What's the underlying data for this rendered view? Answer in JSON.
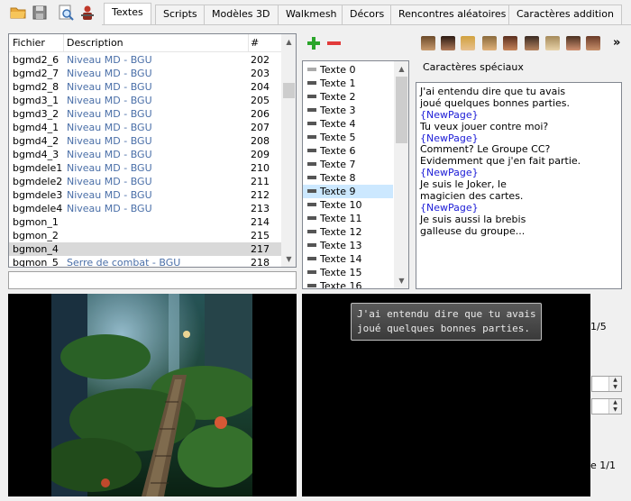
{
  "toolbar": {
    "icons": [
      "open-folder-icon",
      "save-icon",
      "search-document-icon",
      "character-icon"
    ]
  },
  "tabs": [
    {
      "label": "Textes",
      "active": true
    },
    {
      "label": "Scripts",
      "active": false
    },
    {
      "label": "Modèles 3D",
      "active": false
    },
    {
      "label": "Walkmesh",
      "active": false
    },
    {
      "label": "Décors",
      "active": false
    },
    {
      "label": "Rencontres aléatoires",
      "active": false
    },
    {
      "label": "Caractères addition",
      "active": false
    }
  ],
  "file_list": {
    "headers": {
      "file": "Fichier",
      "description": "Description",
      "number": "#"
    },
    "rows": [
      {
        "file": "bgmd2_6",
        "description": "Niveau MD - BGU",
        "number": "202"
      },
      {
        "file": "bgmd2_7",
        "description": "Niveau MD - BGU",
        "number": "203"
      },
      {
        "file": "bgmd2_8",
        "description": "Niveau MD - BGU",
        "number": "204"
      },
      {
        "file": "bgmd3_1",
        "description": "Niveau MD - BGU",
        "number": "205"
      },
      {
        "file": "bgmd3_2",
        "description": "Niveau MD - BGU",
        "number": "206"
      },
      {
        "file": "bgmd4_1",
        "description": "Niveau MD - BGU",
        "number": "207"
      },
      {
        "file": "bgmd4_2",
        "description": "Niveau MD - BGU",
        "number": "208"
      },
      {
        "file": "bgmd4_3",
        "description": "Niveau MD - BGU",
        "number": "209"
      },
      {
        "file": "bgmdele1",
        "description": "Niveau MD - BGU",
        "number": "210"
      },
      {
        "file": "bgmdele2",
        "description": "Niveau MD - BGU",
        "number": "211"
      },
      {
        "file": "bgmdele3",
        "description": "Niveau MD - BGU",
        "number": "212"
      },
      {
        "file": "bgmdele4",
        "description": "Niveau MD - BGU",
        "number": "213"
      },
      {
        "file": "bgmon_1",
        "description": "",
        "number": "214"
      },
      {
        "file": "bgmon_2",
        "description": "",
        "number": "215"
      },
      {
        "file": "bgmon_4",
        "description": "",
        "number": "217",
        "selected": true
      },
      {
        "file": "bgmon_5",
        "description": "Serre de combat - BGU",
        "number": "218"
      }
    ],
    "search_value": ""
  },
  "text_list": {
    "items": [
      {
        "label": "Texte 0",
        "selected": false
      },
      {
        "label": "Texte 1",
        "selected": false
      },
      {
        "label": "Texte 2",
        "selected": false
      },
      {
        "label": "Texte 3",
        "selected": false
      },
      {
        "label": "Texte 4",
        "selected": false
      },
      {
        "label": "Texte 5",
        "selected": false
      },
      {
        "label": "Texte 6",
        "selected": false
      },
      {
        "label": "Texte 7",
        "selected": false
      },
      {
        "label": "Texte 8",
        "selected": false
      },
      {
        "label": "Texte 9",
        "selected": true
      },
      {
        "label": "Texte 10",
        "selected": false
      },
      {
        "label": "Texte 11",
        "selected": false
      },
      {
        "label": "Texte 12",
        "selected": false
      },
      {
        "label": "Texte 13",
        "selected": false
      },
      {
        "label": "Texte 14",
        "selected": false
      },
      {
        "label": "Texte 15",
        "selected": false
      },
      {
        "label": "Texte 16",
        "selected": false
      }
    ]
  },
  "special_chars": {
    "label": "Caractères spéciaux"
  },
  "dialog_text": {
    "lines": [
      "J'ai entendu dire que tu avais",
      "joué quelques bonnes parties.",
      "{NewPage}",
      "Tu veux jouer contre moi?",
      "{NewPage}",
      "Comment? Le Groupe CC?",
      "Evidemment que j'en fait partie.",
      "{NewPage}",
      "Je suis le Joker, le",
      "magicien des cartes.",
      "{NewPage}",
      "Je suis aussi la brebis",
      "galleuse du groupe..."
    ]
  },
  "preview": {
    "line1": "J'ai entendu dire que tu avais",
    "line2": "joué quelques bonnes parties."
  },
  "side": {
    "page_counter": "1/5",
    "page_footer": "e 1/1"
  },
  "colors": {
    "selection": "#cce8ff",
    "description_text": "#4a6fa8",
    "newpage_tag": "#1a1ad6"
  }
}
